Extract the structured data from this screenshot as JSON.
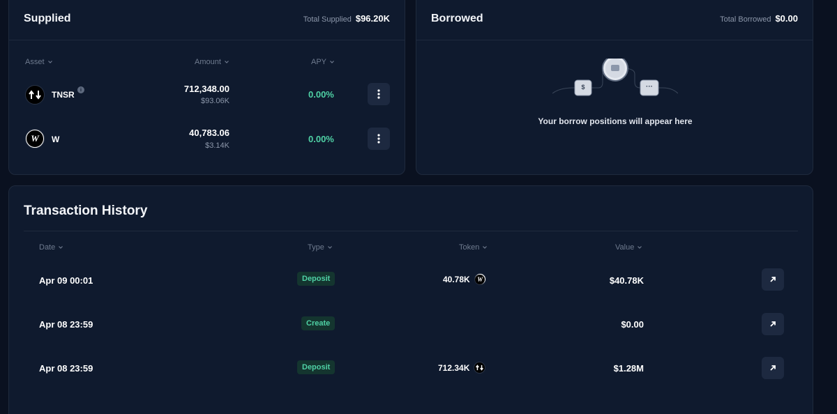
{
  "supplied": {
    "title": "Supplied",
    "total_label": "Total Supplied",
    "total_value": "$96.20K",
    "headers": {
      "asset": "Asset",
      "amount": "Amount",
      "apy": "APY"
    },
    "rows": [
      {
        "icon": "tensor-logo-icon",
        "name": "TNSR",
        "amount": "712,348.00",
        "usd": "$93.06K",
        "apy": "0.00%"
      },
      {
        "icon": "wormhole-logo-icon",
        "name": "W",
        "amount": "40,783.06",
        "usd": "$3.14K",
        "apy": "0.00%"
      }
    ]
  },
  "borrowed": {
    "title": "Borrowed",
    "total_label": "Total Borrowed",
    "total_value": "$0.00",
    "empty_message": "Your borrow positions will appear here",
    "illustration_left_glyph": "$",
    "illustration_right_glyph": "···"
  },
  "history": {
    "title": "Transaction History",
    "headers": {
      "date": "Date",
      "type": "Type",
      "token": "Token",
      "value": "Value"
    },
    "rows": [
      {
        "date": "Apr 09 00:01",
        "type": "Deposit",
        "token_amount": "40.78K",
        "token_icon": "wormhole-logo-icon",
        "value": "$40.78K"
      },
      {
        "date": "Apr 08 23:59",
        "type": "Create",
        "token_amount": "",
        "token_icon": "",
        "value": "$0.00"
      },
      {
        "date": "Apr 08 23:59",
        "type": "Deposit",
        "token_amount": "712.34K",
        "token_icon": "tensor-logo-icon",
        "value": "$1.28M"
      }
    ]
  },
  "colors": {
    "background": "#0a1120",
    "card": "#0f1a2e",
    "accent_green": "#4fd1a5",
    "badge_bg": "#14352f"
  }
}
